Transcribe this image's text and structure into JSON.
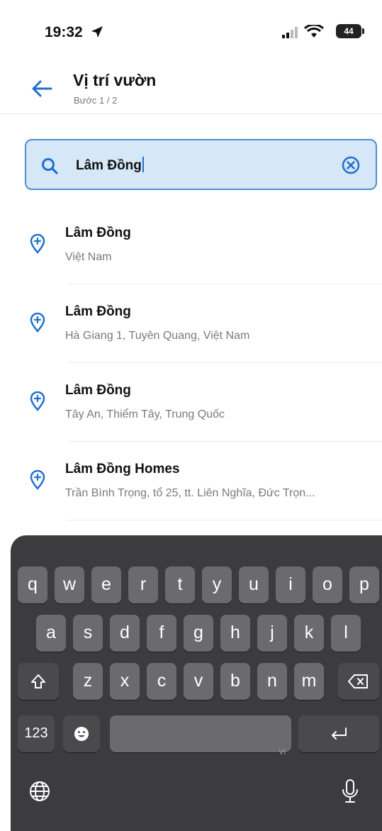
{
  "status_bar": {
    "time": "19:32",
    "battery": "44"
  },
  "header": {
    "title": "Vị trí vườn",
    "subtitle": "Bước 1 / 2"
  },
  "search": {
    "value": "Lâm Đồng"
  },
  "results": [
    {
      "title": "Lâm Đồng",
      "subtitle": "Việt Nam"
    },
    {
      "title": "Lâm Đồng",
      "subtitle": "Hà Giang 1, Tuyên Quang, Việt Nam"
    },
    {
      "title": "Lâm Đồng",
      "subtitle": "Tây An, Thiểm Tây, Trung Quốc"
    },
    {
      "title": "Lâm Đồng Homes",
      "subtitle": "Trần Bình Trọng, tổ 25, tt. Liên Nghĩa, Đức Trọn..."
    }
  ],
  "keyboard": {
    "row1": [
      "q",
      "w",
      "e",
      "r",
      "t",
      "y",
      "u",
      "i",
      "o",
      "p"
    ],
    "row2": [
      "a",
      "s",
      "d",
      "f",
      "g",
      "h",
      "j",
      "k",
      "l"
    ],
    "row3": [
      "z",
      "x",
      "c",
      "v",
      "b",
      "n",
      "m"
    ],
    "numbers_label": "123",
    "space_lang": "VI"
  },
  "icons": {
    "pin": "location-pin-icon",
    "search": "search-icon",
    "clear": "clear-icon",
    "back": "back-arrow-icon"
  },
  "colors": {
    "accent": "#1f6fd0",
    "search_bg": "#d6e7f8",
    "keyboard_bg": "#3c3c3e"
  }
}
